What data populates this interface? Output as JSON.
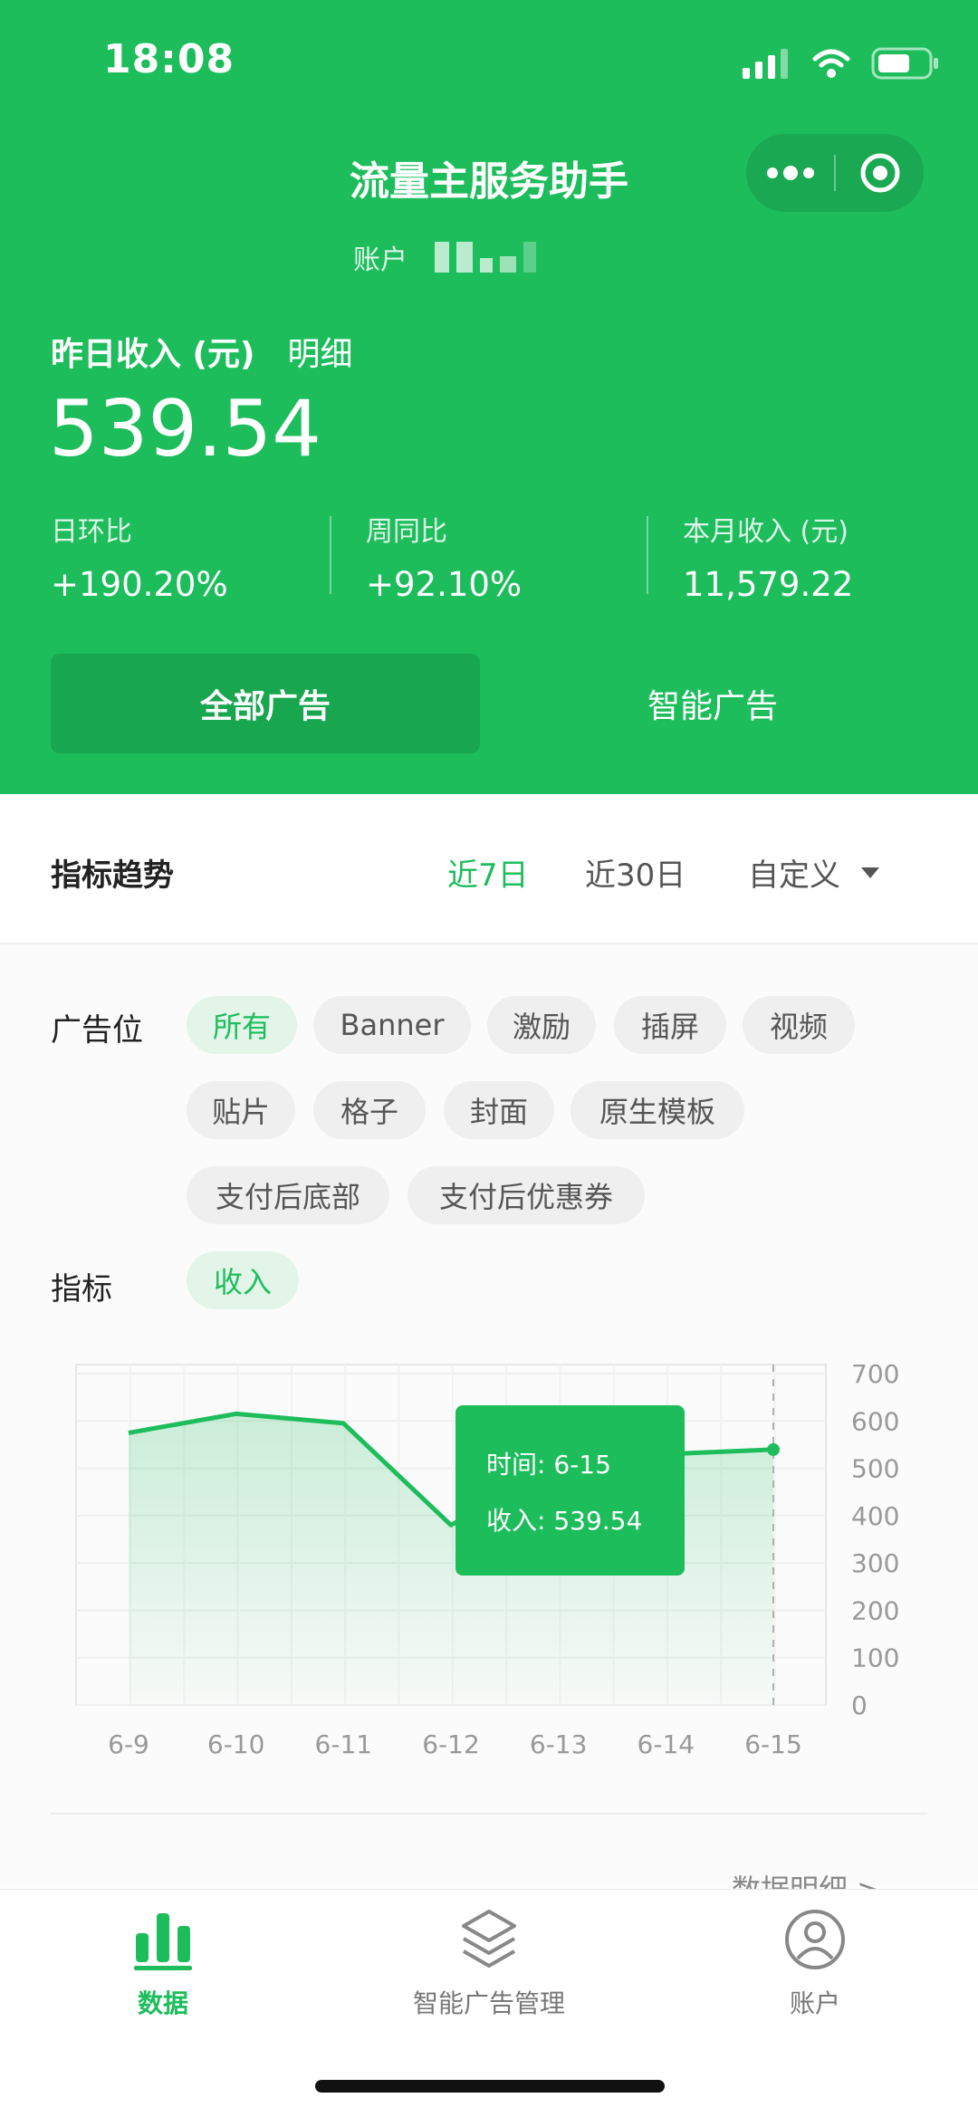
{
  "status_bar": {
    "time": "18:08"
  },
  "header": {
    "title": "流量主服务助手",
    "account_label": "账户"
  },
  "income": {
    "label": "昨日收入 (元)",
    "detail_link": "明细",
    "value": "539.54",
    "stats": [
      {
        "label": "日环比",
        "value": "+190.20%"
      },
      {
        "label": "周同比",
        "value": "+92.10%"
      },
      {
        "label": "本月收入 (元)",
        "value": "11,579.22"
      }
    ]
  },
  "ad_tabs": [
    {
      "label": "全部广告",
      "active": true
    },
    {
      "label": "智能广告",
      "active": false
    }
  ],
  "trend": {
    "title": "指标趋势",
    "ranges": [
      "近7日",
      "近30日",
      "自定义"
    ],
    "active_range": "近7日"
  },
  "filters": {
    "ad_slot_label": "广告位",
    "ad_slots": [
      "所有",
      "Banner",
      "激励",
      "插屏",
      "视频",
      "贴片",
      "格子",
      "封面",
      "原生模板",
      "支付后底部",
      "支付后优惠券"
    ],
    "active_slot": "所有",
    "metric_label": "指标",
    "metrics": [
      "收入"
    ],
    "active_metric": "收入"
  },
  "chart_data": {
    "type": "area",
    "x": [
      "6-9",
      "6-10",
      "6-11",
      "6-12",
      "6-13",
      "6-14",
      "6-15"
    ],
    "series": [
      {
        "values": [
          575,
          615,
          595,
          380,
          502,
          530,
          539.54
        ]
      }
    ],
    "ylim": [
      0,
      700
    ],
    "yticks": [
      "700",
      "600",
      "500",
      "400",
      "300",
      "200",
      "100",
      "0"
    ],
    "colors": {
      "line": "#1dbd5c"
    },
    "tooltip": {
      "time_label": "时间: 6-15",
      "value_label": "收入: 539.54"
    }
  },
  "peek_link": "数据明细 >",
  "bottom_nav": [
    {
      "label": "数据",
      "icon": "bar-chart-icon",
      "active": true
    },
    {
      "label": "智能广告管理",
      "icon": "layers-icon",
      "active": false
    },
    {
      "label": "账户",
      "icon": "user-circle-icon",
      "active": false
    }
  ],
  "colors": {
    "brand": "#1dbd5c",
    "brand_dark": "#18a64f"
  }
}
